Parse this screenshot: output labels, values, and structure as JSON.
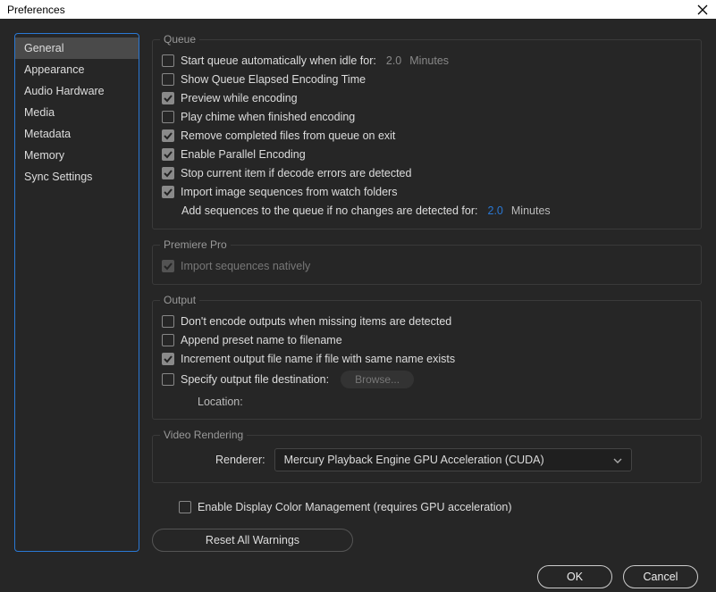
{
  "title": "Preferences",
  "sidebar": {
    "items": [
      {
        "label": "General",
        "active": true
      },
      {
        "label": "Appearance"
      },
      {
        "label": "Audio Hardware"
      },
      {
        "label": "Media"
      },
      {
        "label": "Metadata"
      },
      {
        "label": "Memory"
      },
      {
        "label": "Sync Settings"
      }
    ]
  },
  "queue": {
    "legend": "Queue",
    "items": [
      {
        "label": "Start queue automatically when idle for:",
        "checked": false,
        "value": "2.0",
        "unit": "Minutes",
        "value_style": "dim"
      },
      {
        "label": "Show Queue Elapsed Encoding Time",
        "checked": false
      },
      {
        "label": "Preview while encoding",
        "checked": true
      },
      {
        "label": "Play chime when finished encoding",
        "checked": false
      },
      {
        "label": "Remove completed files from queue on exit",
        "checked": true
      },
      {
        "label": "Enable Parallel Encoding",
        "checked": true
      },
      {
        "label": "Stop current item if decode errors are detected",
        "checked": true
      },
      {
        "label": "Import image sequences from watch folders",
        "checked": true
      }
    ],
    "sub": {
      "label": "Add sequences to the queue if no changes are detected for:",
      "value": "2.0",
      "unit": "Minutes"
    }
  },
  "premiere": {
    "legend": "Premiere Pro",
    "item": {
      "label": "Import sequences natively",
      "checked": true,
      "disabled": true
    }
  },
  "output": {
    "legend": "Output",
    "items": [
      {
        "label": "Don't encode outputs when missing items are detected",
        "checked": false
      },
      {
        "label": "Append preset name to filename",
        "checked": false
      },
      {
        "label": "Increment output file name if file with same name exists",
        "checked": true
      },
      {
        "label": "Specify output file destination:",
        "checked": false,
        "browse": "Browse..."
      }
    ],
    "location_label": "Location:"
  },
  "video": {
    "legend": "Video Rendering",
    "renderer_label": "Renderer:",
    "renderer_value": "Mercury Playback Engine GPU Acceleration (CUDA)"
  },
  "color_mgmt": {
    "label": "Enable Display Color Management (requires GPU acceleration)",
    "checked": false
  },
  "reset_warnings": "Reset All Warnings",
  "footer": {
    "ok": "OK",
    "cancel": "Cancel"
  }
}
